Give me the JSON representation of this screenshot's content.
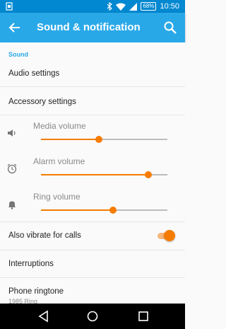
{
  "status_bar": {
    "battery": "68",
    "time": "10:50",
    "icons": [
      "notification-icon",
      "bluetooth-icon",
      "wifi-icon",
      "signal-icon",
      "battery-icon"
    ]
  },
  "app_bar": {
    "title": "Sound & notification",
    "icons": [
      "back-arrow-icon",
      "search-icon"
    ]
  },
  "section": "Sound",
  "items": {
    "audio_settings": "Audio settings",
    "accessory_settings": "Accessory settings",
    "media_volume": "Media volume",
    "alarm_volume": "Alarm volume",
    "ring_volume": "Ring volume",
    "vibrate": "Also vibrate for calls",
    "interruptions": "Interruptions",
    "phone_ringtone": "Phone ringtone",
    "phone_ringtone_value": "1985 Ring"
  },
  "volumes": {
    "media": 0.46,
    "alarm": 0.85,
    "ring": 0.57
  },
  "vibrate_enabled": true,
  "colors": {
    "status_bar": "#0288d1",
    "app_bar": "#29a8e8",
    "accent": "#f57c00",
    "background": "#fafafa"
  },
  "nav_bar_icons": [
    "back-triangle-icon",
    "home-circle-icon",
    "recents-square-icon"
  ]
}
